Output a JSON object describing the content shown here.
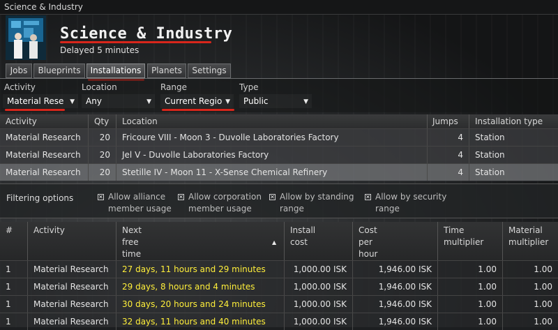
{
  "window": {
    "title": "Science & Industry"
  },
  "header": {
    "title": "Science & Industry",
    "subtitle": "Delayed 5 minutes"
  },
  "tabs": [
    {
      "label": "Jobs",
      "active": false
    },
    {
      "label": "Blueprints",
      "active": false
    },
    {
      "label": "Installations",
      "active": true
    },
    {
      "label": "Planets",
      "active": false
    },
    {
      "label": "Settings",
      "active": false
    }
  ],
  "filters": {
    "activity": {
      "label": "Activity",
      "value": "Material Rese"
    },
    "location": {
      "label": "Location",
      "value": "Any"
    },
    "range": {
      "label": "Range",
      "value": "Current Regio"
    },
    "type": {
      "label": "Type",
      "value": "Public"
    }
  },
  "installations_table": {
    "headers": [
      "Activity",
      "Qty",
      "Location",
      "Jumps",
      "Installation type"
    ],
    "rows": [
      {
        "activity": "Material Research",
        "qty": "20",
        "location": "Fricoure VIII - Moon 3 - Duvolle Laboratories Factory",
        "jumps": "4",
        "type": "Station"
      },
      {
        "activity": "Material Research",
        "qty": "20",
        "location": "Jel V - Duvolle Laboratories Factory",
        "jumps": "4",
        "type": "Station"
      },
      {
        "activity": "Material Research",
        "qty": "20",
        "location": "Stetille IV - Moon 11 - X-Sense Chemical Refinery",
        "jumps": "4",
        "type": "Station"
      }
    ]
  },
  "filtering_options": {
    "label": "Filtering options",
    "options": [
      {
        "line1": "Allow alliance",
        "line2": "member usage",
        "checked": true
      },
      {
        "line1": "Allow corporation",
        "line2": "member usage",
        "checked": true
      },
      {
        "line1": "Allow by standing",
        "line2": "range",
        "checked": true
      },
      {
        "line1": "Allow by security",
        "line2": "range",
        "checked": true
      }
    ],
    "checkmark": "✕"
  },
  "slots_table": {
    "headers": {
      "num": "#",
      "activity": "Activity",
      "next_free": [
        "Next",
        "free",
        "time"
      ],
      "install_cost": [
        "Install",
        "cost"
      ],
      "cost_per_hour": [
        "Cost",
        "per",
        "hour"
      ],
      "time_mult": [
        "Time",
        "multiplier"
      ],
      "mat_mult": [
        "Material",
        "multiplier"
      ]
    },
    "rows": [
      {
        "num": "1",
        "activity": "Material Research",
        "next_free": "27 days, 11 hours and 29 minutes",
        "install_cost": "1,000.00 ISK",
        "cost_per_hour": "1,946.00 ISK",
        "time_mult": "1.00",
        "mat_mult": "1.00"
      },
      {
        "num": "1",
        "activity": "Material Research",
        "next_free": "29 days, 8 hours and 4 minutes",
        "install_cost": "1,000.00 ISK",
        "cost_per_hour": "1,946.00 ISK",
        "time_mult": "1.00",
        "mat_mult": "1.00"
      },
      {
        "num": "1",
        "activity": "Material Research",
        "next_free": "30 days, 20 hours and 24 minutes",
        "install_cost": "1,000.00 ISK",
        "cost_per_hour": "1,946.00 ISK",
        "time_mult": "1.00",
        "mat_mult": "1.00"
      },
      {
        "num": "1",
        "activity": "Material Research",
        "next_free": "32 days, 11 hours and 40 minutes",
        "install_cost": "1,000.00 ISK",
        "cost_per_hour": "1,946.00 ISK",
        "time_mult": "1.00",
        "mat_mult": "1.00"
      }
    ]
  },
  "icons": {
    "dropdown": "chevron-down-icon",
    "sort": "sort-ascending-icon",
    "header": "scientists-icon"
  },
  "colors": {
    "highlight": "#d8261b",
    "time_text": "#ffef3a"
  }
}
